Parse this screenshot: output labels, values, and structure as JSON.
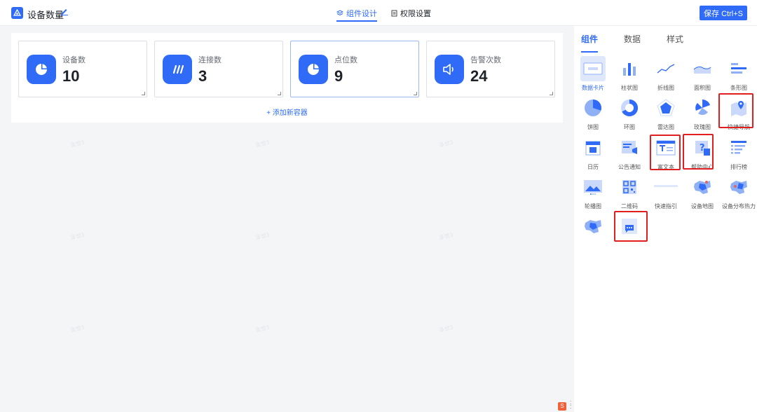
{
  "header": {
    "title": "设备数量",
    "tabs": [
      {
        "label": "组件设计",
        "active": true
      },
      {
        "label": "权限设置",
        "active": false
      }
    ],
    "save_label": "保存 Ctrl+S"
  },
  "canvas": {
    "cards": [
      {
        "label": "设备数",
        "value": "10",
        "icon": "pie-chart-icon"
      },
      {
        "label": "连接数",
        "value": "3",
        "icon": "slashes-icon"
      },
      {
        "label": "点位数",
        "value": "9",
        "icon": "pie-chart-icon"
      },
      {
        "label": "告警次数",
        "value": "24",
        "icon": "speaker-icon"
      }
    ],
    "add_container_label": "+ 添加新容器"
  },
  "watermark_text": "泽世3",
  "panel": {
    "tabs": [
      {
        "label": "组件",
        "active": true
      },
      {
        "label": "数据",
        "active": false
      },
      {
        "label": "样式",
        "active": false
      }
    ],
    "components": [
      {
        "label": "数据卡片",
        "icon": "data-card-icon",
        "active": true
      },
      {
        "label": "柱状图",
        "icon": "bar-chart-icon"
      },
      {
        "label": "折线图",
        "icon": "line-chart-icon"
      },
      {
        "label": "面积图",
        "icon": "area-chart-icon"
      },
      {
        "label": "条形图",
        "icon": "horizontal-bar-icon"
      },
      {
        "label": "饼图",
        "icon": "pie-icon"
      },
      {
        "label": "环图",
        "icon": "donut-icon"
      },
      {
        "label": "雷达图",
        "icon": "radar-icon"
      },
      {
        "label": "玫瑰图",
        "icon": "rose-icon"
      },
      {
        "label": "快捷导航",
        "icon": "map-pin-icon",
        "highlighted": true
      },
      {
        "label": "日历",
        "icon": "calendar-icon"
      },
      {
        "label": "公告通知",
        "icon": "announcement-icon"
      },
      {
        "label": "富文本",
        "icon": "rich-text-icon",
        "highlighted": true
      },
      {
        "label": "帮助中心",
        "icon": "help-icon",
        "highlighted": true
      },
      {
        "label": "排行榜",
        "icon": "ranking-icon"
      },
      {
        "label": "轮播图",
        "icon": "carousel-icon"
      },
      {
        "label": "二维码",
        "icon": "qrcode-icon"
      },
      {
        "label": "快速指引",
        "icon": "quick-guide-icon"
      },
      {
        "label": "设备地图",
        "icon": "device-map-icon"
      },
      {
        "label": "设备分布热力",
        "icon": "heat-map-icon"
      },
      {
        "label": "",
        "icon": "map-icon"
      },
      {
        "label": "",
        "icon": "chat-icon",
        "highlighted": true
      }
    ]
  },
  "colors": {
    "accent": "#2f6bf7",
    "highlight": "#e02020",
    "card_icon_bg": "#2f6bf7"
  }
}
